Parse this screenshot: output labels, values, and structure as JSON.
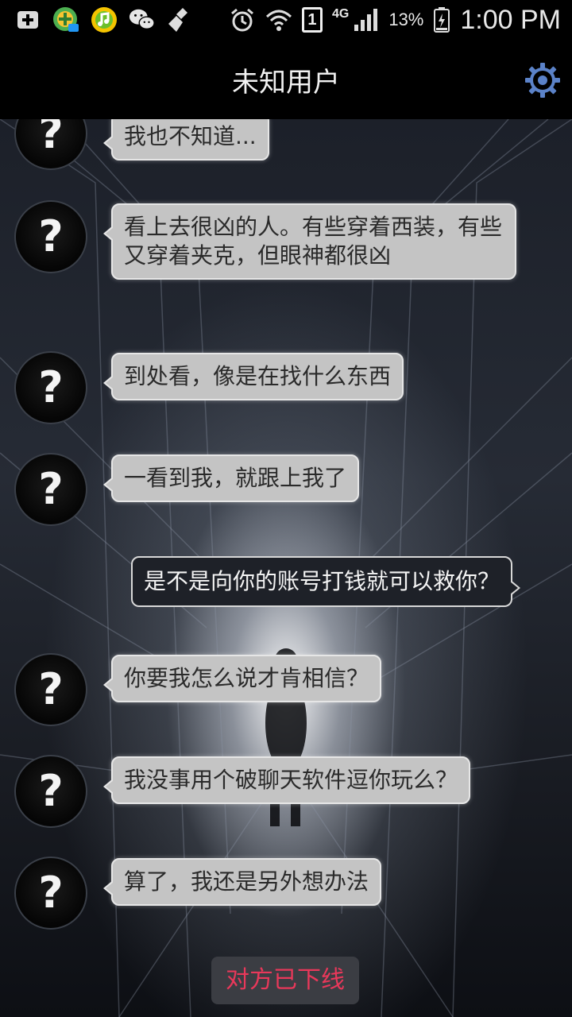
{
  "status_bar": {
    "left_icons": [
      "add-notification-icon",
      "qq-icon",
      "music-icon",
      "wechat-icon",
      "cleaner-icon"
    ],
    "right_icons": [
      "alarm-icon",
      "wifi-icon",
      "sim-icon",
      "signal-icon",
      "battery-icon"
    ],
    "sim_number": "1",
    "network": "4G",
    "battery": "13%",
    "time": "1:00 PM"
  },
  "header": {
    "title": "未知用户",
    "settings_icon": "gear-icon"
  },
  "avatar_glyph": "?",
  "messages": [
    {
      "from": "them",
      "text": "我也不知道..."
    },
    {
      "from": "them",
      "text": "看上去很凶的人。有些穿着西装，有些又穿着夹克，但眼神都很凶"
    },
    {
      "from": "them",
      "text": "到处看，像是在找什么东西"
    },
    {
      "from": "them",
      "text": "一看到我，就跟上我了"
    },
    {
      "from": "me",
      "text": "是不是向你的账号打钱就可以救你？"
    },
    {
      "from": "them",
      "text": "你要我怎么说才肯相信？"
    },
    {
      "from": "them",
      "text": "我没事用个破聊天软件逗你玩么？"
    },
    {
      "from": "them",
      "text": "算了，我还是另外想办法"
    }
  ],
  "status_notice": "对方已下线",
  "colors": {
    "incoming_bubble": "#c4c4c4",
    "outgoing_bubble": "#1e2128",
    "offline_text": "#e8385a",
    "gear_icon": "#5b82c8"
  }
}
